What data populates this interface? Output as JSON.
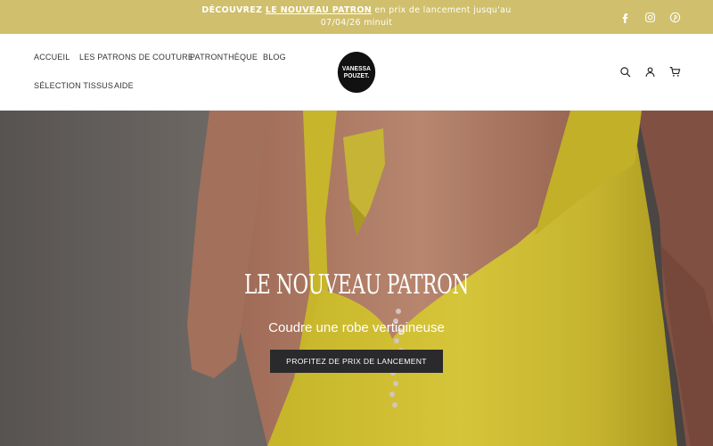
{
  "announcement": {
    "prefix": "DÉCOUVREZ ",
    "link": "LE NOUVEAU PATRON",
    "suffix": " en prix de lancement jusqu'au",
    "line2": "07/04/26 minuit"
  },
  "social": [
    {
      "name": "facebook-icon"
    },
    {
      "name": "instagram-icon"
    },
    {
      "name": "pinterest-icon"
    }
  ],
  "nav": {
    "items": [
      {
        "label": "ACCUEIL"
      },
      {
        "label": "LES PATRONS DE COUTURE"
      },
      {
        "label": "PATRONTHÈQUE"
      },
      {
        "label": "BLOG"
      },
      {
        "label": "SÉLECTION TISSUS"
      },
      {
        "label": "AIDE"
      }
    ]
  },
  "logo": {
    "line1": "VANESSA",
    "line2": "POUZET."
  },
  "header_icons": [
    "search-icon",
    "account-icon",
    "cart-icon"
  ],
  "colors": {
    "announcement_bg": "#d0bf6c",
    "dress": "#e4d23a",
    "button_bg": "#2a2a2c"
  },
  "hero": {
    "title": "LE NOUVEAU PATRON",
    "subtitle": "Coudre une robe vertigineuse",
    "cta": "PROFITEZ DE PRIX DE LANCEMENT"
  }
}
